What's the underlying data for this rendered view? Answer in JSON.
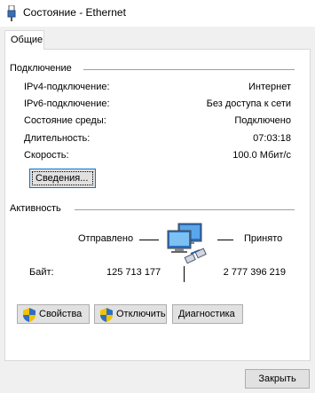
{
  "window": {
    "title": "Состояние - Ethernet"
  },
  "tabs": [
    {
      "label": "Общие"
    }
  ],
  "connection": {
    "title": "Подключение",
    "rows": [
      {
        "label": "IPv4-подключение:",
        "value": "Интернет"
      },
      {
        "label": "IPv6-подключение:",
        "value": "Без доступа к сети"
      },
      {
        "label": "Состояние среды:",
        "value": "Подключено"
      },
      {
        "label": "Длительность:",
        "value": "07:03:18"
      },
      {
        "label": "Скорость:",
        "value": "100.0 Мбит/с"
      }
    ],
    "details_button": "Сведения..."
  },
  "activity": {
    "title": "Активность",
    "sent_label": "Отправлено",
    "received_label": "Принято",
    "bytes_label": "Байт:",
    "bytes_sent": "125 713 177",
    "bytes_received": "2 777 396 219",
    "icon": "network-computers-icon"
  },
  "buttons": {
    "properties": "Свойства",
    "disable": "Отключить",
    "diagnose": "Диагностика",
    "close": "Закрыть"
  },
  "icons": {
    "title": "ethernet-plug-icon",
    "uac": "uac-shield-icon"
  }
}
